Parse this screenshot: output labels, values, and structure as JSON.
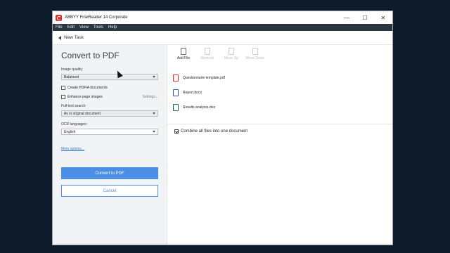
{
  "window": {
    "title": "ABBYY FineReader 14 Corporate",
    "controls": {
      "minimize": "—",
      "maximize": "☐",
      "close": "✕"
    }
  },
  "menu": [
    "File",
    "Edit",
    "View",
    "Tools",
    "Help"
  ],
  "task": {
    "back_label": "New Task"
  },
  "left": {
    "heading": "Convert to PDF",
    "image_quality": {
      "label": "Image quality:",
      "value": "Balanced"
    },
    "create_pdfa": "Create PDF/A documents",
    "enhance": "Enhance page images",
    "settings": "Settings...",
    "fulltext": {
      "label": "Full-text search:",
      "value": "As in original document"
    },
    "ocr": {
      "label": "OCR languages:",
      "value": "English"
    },
    "more_options": "More options...",
    "convert_button": "Convert to PDF",
    "cancel_button": "Cancel"
  },
  "toolbar": {
    "add_file": "Add File",
    "remove": "Remove",
    "move_up": "Move Up",
    "move_down": "Move Down"
  },
  "files": [
    {
      "name": "Questionnaire template.pdf",
      "color": "#d9302e"
    },
    {
      "name": "Report.docx",
      "color": "#2b5bb0"
    },
    {
      "name": "Results analysis.xlsx",
      "color": "#1f7a3f"
    }
  ],
  "combine": {
    "label": "Combine all files into one document",
    "checked": true
  }
}
